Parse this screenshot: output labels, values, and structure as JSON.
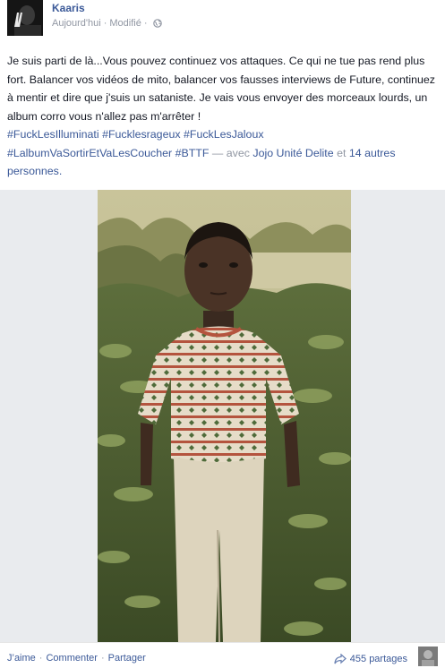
{
  "post": {
    "author": "Kaaris",
    "timestamp": "Aujourd'hui",
    "edited_label": "Modifié",
    "privacy_icon": "globe-icon",
    "text_main": "Je suis parti de là...Vous pouvez continuez vos attaques. Ce qui ne tue pas rend plus fort. Balancer vos vidéos de mito, balancer vos fausses interviews de Future, continuez à mentir et dire que j'suis un sataniste. Je vais vous envoyer des morceaux lourds, un album corro vous n'allez pas m'arrêter !",
    "hashtags": [
      "#FuckLesIlluminati",
      "#Fucklesrageux",
      "#FuckLesJaloux",
      "#LalbumVaSortirEtVaLesCoucher",
      "#BTTF"
    ],
    "with_label": "— avec",
    "tagged_person": "Jojo Unité Delite",
    "and_label": "et",
    "others_label": "14 autres personnes."
  },
  "actions": {
    "like": "J’aime",
    "comment": "Commenter",
    "share": "Partager",
    "separator": "·",
    "share_count": "455 partages"
  },
  "colors": {
    "link": "#3b5998",
    "meta": "#9197a3",
    "text": "#141823",
    "photo_bg": "#e9ebee"
  }
}
